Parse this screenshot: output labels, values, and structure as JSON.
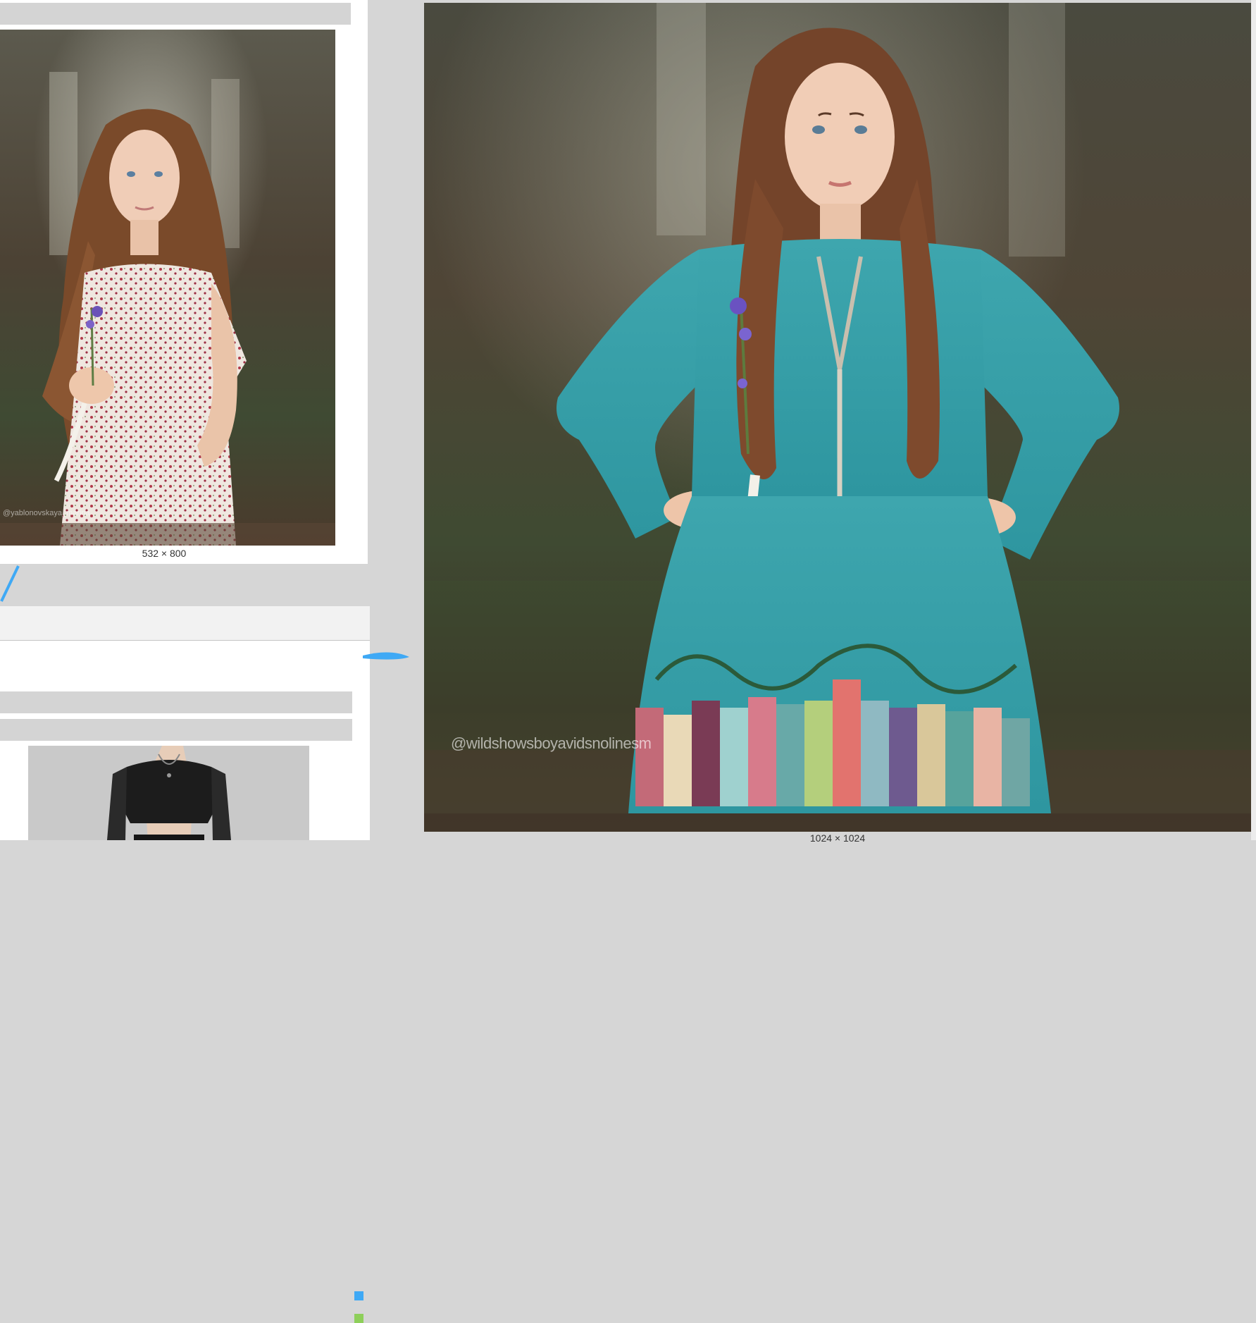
{
  "reference_image": {
    "dimensions_label": "532 × 800",
    "watermark": "@yablonovskaya_marina"
  },
  "preview_image": {
    "dimensions_label": "1024 × 1024",
    "watermark": "@wildshowsboyavidsnolinesm"
  },
  "colors": {
    "canvas_bg": "#d6d6d6",
    "node_bg": "#ffffff",
    "widget_bar": "#d4d4d4",
    "port_image": "#3fa9f5",
    "port_mask": "#8ecf5a",
    "wire": "#3fa9f5"
  },
  "icons": {
    "input_port_image": "blue-square-port",
    "input_port_mask": "green-square-port"
  }
}
